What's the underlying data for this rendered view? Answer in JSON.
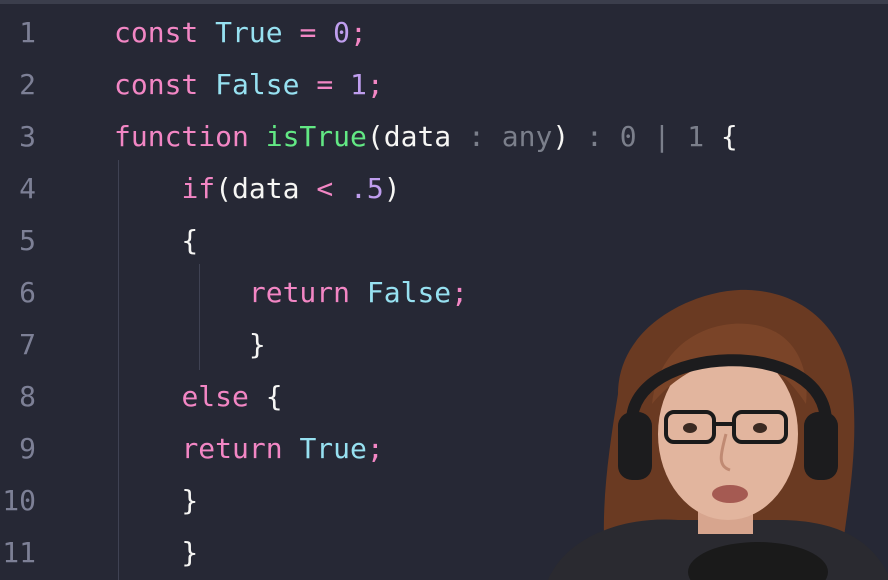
{
  "editor": {
    "theme": {
      "background": "#262835",
      "line_number_color": "#7d8096",
      "keyword_color": "#f286c4",
      "constant_color": "#97e1f1",
      "number_color": "#bf9eee",
      "function_color": "#62e884",
      "type_color": "#7b7f8b"
    },
    "lines": [
      {
        "number": "1",
        "tokens": [
          {
            "text": "const",
            "kind": "kw"
          },
          {
            "text": " ",
            "kind": "plain"
          },
          {
            "text": "True",
            "kind": "const"
          },
          {
            "text": " ",
            "kind": "plain"
          },
          {
            "text": "=",
            "kind": "op"
          },
          {
            "text": " ",
            "kind": "plain"
          },
          {
            "text": "0",
            "kind": "num"
          },
          {
            "text": ";",
            "kind": "op"
          }
        ]
      },
      {
        "number": "2",
        "tokens": [
          {
            "text": "const",
            "kind": "kw"
          },
          {
            "text": " ",
            "kind": "plain"
          },
          {
            "text": "False",
            "kind": "const"
          },
          {
            "text": " ",
            "kind": "plain"
          },
          {
            "text": "=",
            "kind": "op"
          },
          {
            "text": " ",
            "kind": "plain"
          },
          {
            "text": "1",
            "kind": "num"
          },
          {
            "text": ";",
            "kind": "op"
          }
        ]
      },
      {
        "number": "3",
        "tokens": [
          {
            "text": "function",
            "kind": "kw"
          },
          {
            "text": " ",
            "kind": "plain"
          },
          {
            "text": "isTrue",
            "kind": "fn"
          },
          {
            "text": "(data",
            "kind": "plain"
          },
          {
            "text": " : ",
            "kind": "type"
          },
          {
            "text": "any",
            "kind": "type"
          },
          {
            "text": ")",
            "kind": "plain"
          },
          {
            "text": " : ",
            "kind": "type"
          },
          {
            "text": "0",
            "kind": "type"
          },
          {
            "text": " | ",
            "kind": "type"
          },
          {
            "text": "1",
            "kind": "type"
          },
          {
            "text": " {",
            "kind": "plain"
          }
        ]
      },
      {
        "number": "4",
        "tokens": [
          {
            "text": "    ",
            "kind": "plain"
          },
          {
            "text": "if",
            "kind": "kw"
          },
          {
            "text": "(data ",
            "kind": "plain"
          },
          {
            "text": "<",
            "kind": "op"
          },
          {
            "text": " ",
            "kind": "plain"
          },
          {
            "text": ".5",
            "kind": "num"
          },
          {
            "text": ")",
            "kind": "plain"
          }
        ]
      },
      {
        "number": "5",
        "tokens": [
          {
            "text": "    {",
            "kind": "plain"
          }
        ]
      },
      {
        "number": "6",
        "tokens": [
          {
            "text": "        ",
            "kind": "plain"
          },
          {
            "text": "return",
            "kind": "kw"
          },
          {
            "text": " ",
            "kind": "plain"
          },
          {
            "text": "False",
            "kind": "const"
          },
          {
            "text": ";",
            "kind": "op"
          }
        ]
      },
      {
        "number": "7",
        "tokens": [
          {
            "text": "        }",
            "kind": "plain"
          }
        ]
      },
      {
        "number": "8",
        "tokens": [
          {
            "text": "    ",
            "kind": "plain"
          },
          {
            "text": "else",
            "kind": "kw"
          },
          {
            "text": " {",
            "kind": "plain"
          }
        ]
      },
      {
        "number": "9",
        "tokens": [
          {
            "text": "    ",
            "kind": "plain"
          },
          {
            "text": "return",
            "kind": "kw"
          },
          {
            "text": " ",
            "kind": "plain"
          },
          {
            "text": "True",
            "kind": "const"
          },
          {
            "text": ";",
            "kind": "op"
          }
        ]
      },
      {
        "number": "10",
        "tokens": [
          {
            "text": "    }",
            "kind": "plain"
          }
        ]
      },
      {
        "number": "11",
        "tokens": [
          {
            "text": "    }",
            "kind": "plain"
          }
        ]
      }
    ]
  },
  "webcam": {
    "icon": "streamer-webcam-overlay",
    "hair_color": "#6a3a22",
    "skin_color": "#e2b59e",
    "headphone_color": "#1c1c1e"
  }
}
